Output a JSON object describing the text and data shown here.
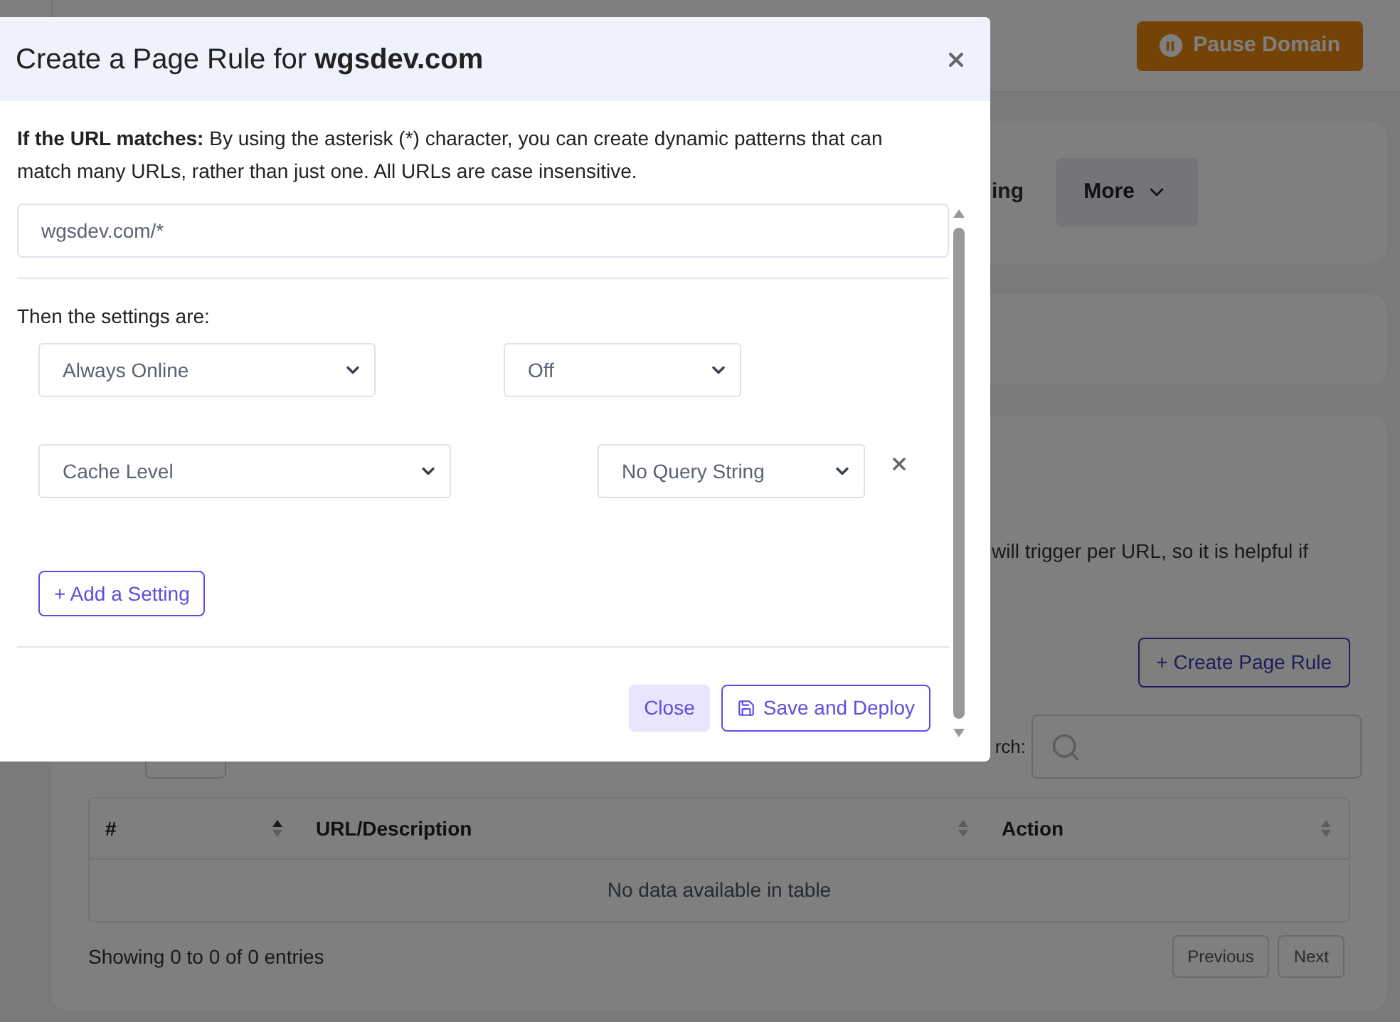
{
  "page": {
    "pause_button": "Pause Domain",
    "tab_fragment": "ing",
    "more_button": "More",
    "description_fragment": "will trigger per URL, so it is helpful if",
    "create_button": "+ Create Page Rule",
    "search_label_fragment": "rch:",
    "table": {
      "columns": [
        {
          "label": "#",
          "sorted": true
        },
        {
          "label": "URL/Description",
          "sorted": false
        },
        {
          "label": "Action",
          "sorted": false
        }
      ],
      "empty_message": "No data available in table"
    },
    "info": "Showing 0 to 0 of 0 entries",
    "pagination": [
      "Previous",
      "Next"
    ]
  },
  "dialog": {
    "title": "Create a Page Rule for **wgsdev.com**",
    "intro_label": "If the URL matches:",
    "intro": "By using the asterisk (*) character, you can create dynamic patterns that can match many URLs, rather than just one. All URLs are case insensitive.",
    "url_value": "wgsdev.com/*",
    "settings_label": "Then the settings are:",
    "settings": [
      {
        "setting": "Always Online",
        "value": "Off",
        "removable": false
      },
      {
        "setting": "Cache Level",
        "value": "No Query String",
        "removable": true
      }
    ],
    "add_button": "+ Add a Setting",
    "close_button": "Close",
    "save_button": "Save and Deploy"
  }
}
